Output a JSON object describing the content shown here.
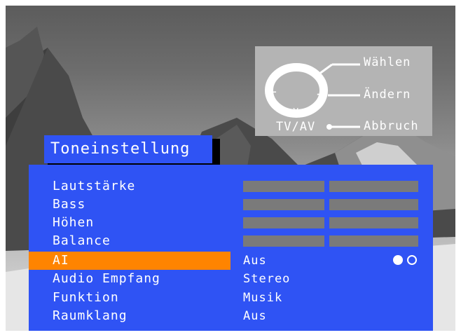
{
  "guide": {
    "select_label": "Wählen",
    "change_label": "Ändern",
    "cancel_label": "Abbruch",
    "source_label": "TV/AV",
    "up_symbol": "^",
    "down_symbol": "v",
    "minus_symbol": "−",
    "plus_symbol": "+"
  },
  "menu": {
    "title": "Toneinstellung",
    "items": [
      {
        "label": "Lautstärke",
        "value": ""
      },
      {
        "label": "Bass",
        "value": ""
      },
      {
        "label": "Höhen",
        "value": ""
      },
      {
        "label": "Balance",
        "value": ""
      },
      {
        "label": "AI",
        "value": "Aus"
      },
      {
        "label": "Audio Empfang",
        "value": "Stereo"
      },
      {
        "label": "Funktion",
        "value": "Musik"
      },
      {
        "label": "Raumklang",
        "value": "Aus"
      }
    ],
    "selected_index": 4
  },
  "colors": {
    "panel": "#2f53f4",
    "highlight": "#ff8400",
    "bar": "#7a7a7a",
    "guide_bg": "#b4b4b4"
  }
}
